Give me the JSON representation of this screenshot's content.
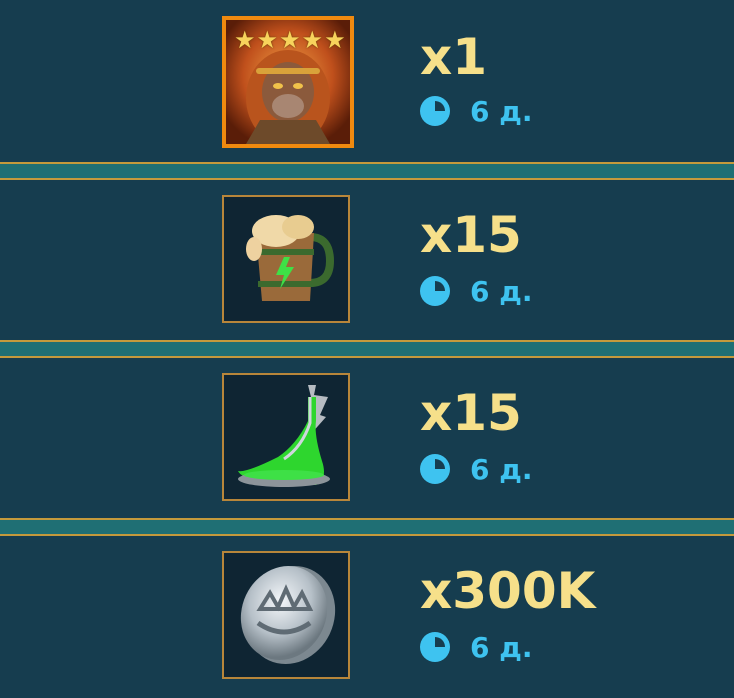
{
  "rewards": [
    {
      "name": "champion",
      "quantity": "x1",
      "timer": "6 д.",
      "icon": "monkey-king-champion-icon",
      "stars": 5
    },
    {
      "name": "brew",
      "quantity": "x15",
      "timer": "6 д.",
      "icon": "energy-brew-mug-icon"
    },
    {
      "name": "potion",
      "quantity": "x15",
      "timer": "6 д.",
      "icon": "green-potion-flask-icon"
    },
    {
      "name": "silver",
      "quantity": "x300K",
      "timer": "6 д.",
      "icon": "silver-coin-icon"
    }
  ],
  "colors": {
    "background": "#163d4f",
    "quantity_text": "#f6e08a",
    "timer_text": "#3ec3f0",
    "champion_frame": "#f08a0f",
    "item_frame": "#b8863a"
  }
}
